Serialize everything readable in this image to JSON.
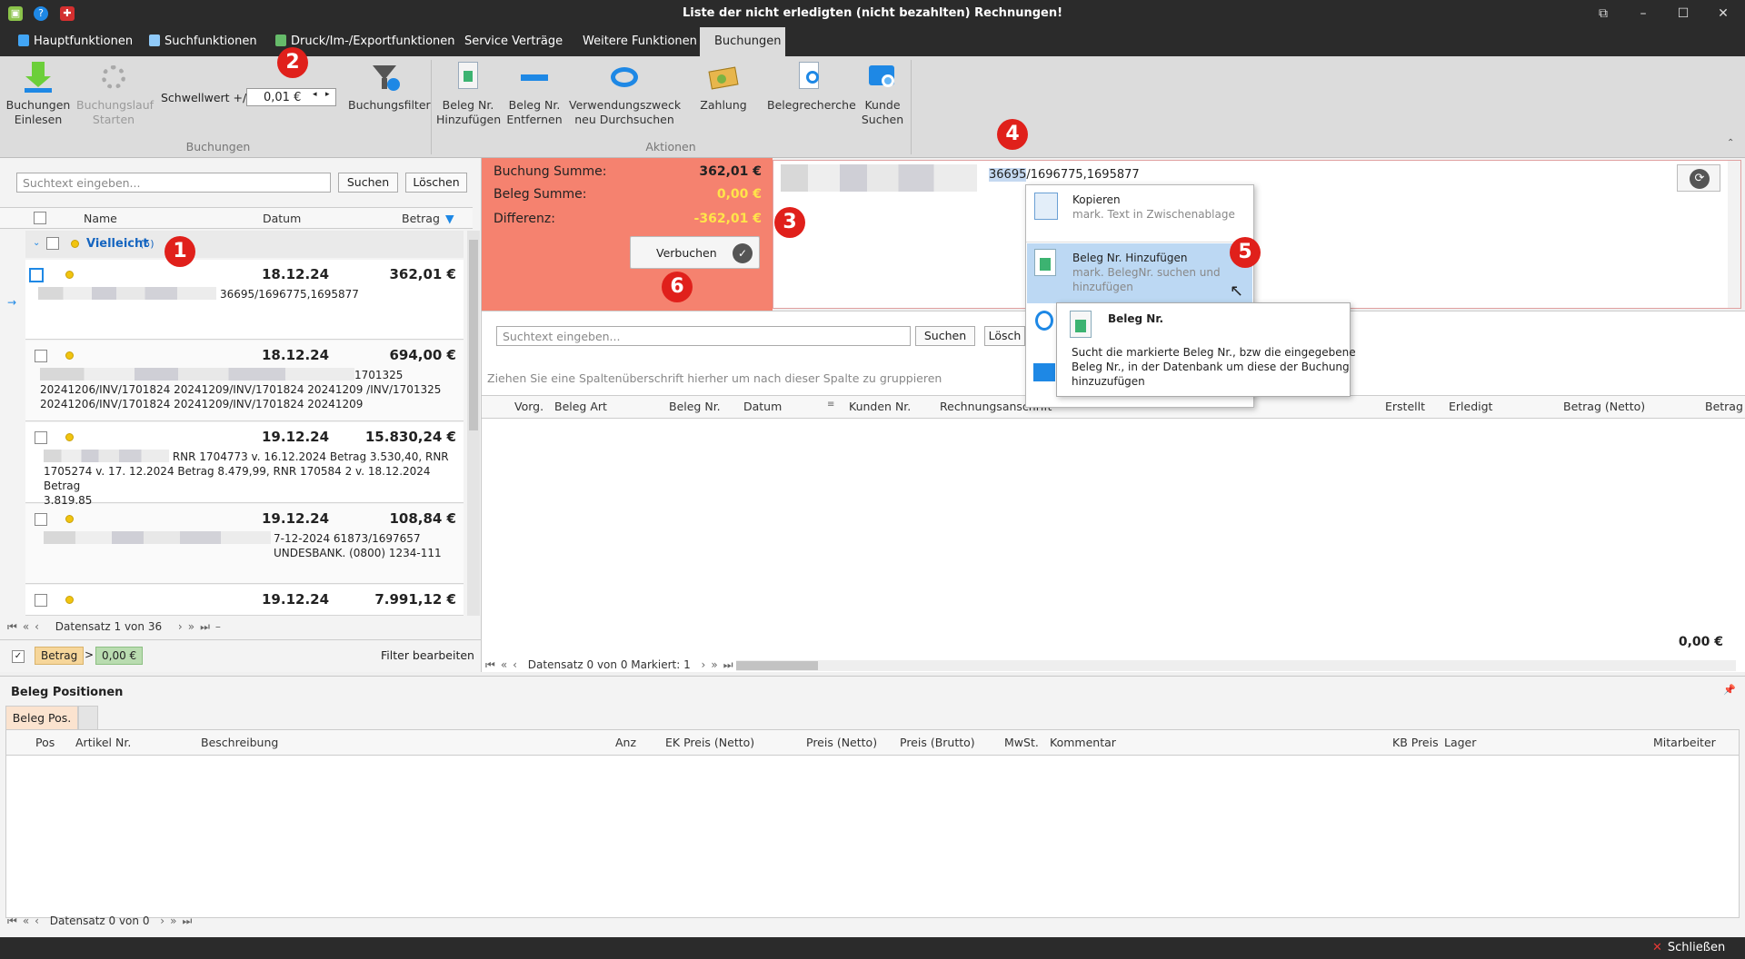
{
  "window": {
    "title": "Liste der nicht erledigten (nicht bezahlten) Rechnungen!"
  },
  "menu": {
    "tabs": [
      "Hauptfunktionen",
      "Suchfunktionen",
      "Druck/Im-/Exportfunktionen",
      "Service Verträge",
      "Weitere Funktionen",
      "Buchungen"
    ],
    "active": "Buchungen"
  },
  "ribbon": {
    "buchungen_einlesen": "Buchungen\nEinlesen",
    "buchungslauf_starten": "Buchungslauf\nStarten",
    "schwellwert_label": "Schwellwert +/-",
    "schwellwert_value": "0,01 €",
    "buchungsfilter": "Buchungsfilter",
    "group_buchungen": "Buchungen",
    "beleg_hinzufuegen": "Beleg Nr.\nHinzufügen",
    "beleg_entfernen": "Beleg Nr.\nEntfernen",
    "verwendungszweck": "Verwendungszweck\nneu Durchsuchen",
    "zahlung": "Zahlung",
    "belegrecherche": "Belegrecherche",
    "kunde_suchen": "Kunde\nSuchen",
    "group_aktionen": "Aktionen"
  },
  "left": {
    "search_placeholder": "Suchtext eingeben...",
    "search_btn": "Suchen",
    "clear_btn": "Löschen",
    "col_name": "Name",
    "col_datum": "Datum",
    "col_betrag": "Betrag",
    "group_label": "Vielleicht",
    "group_count": "(5)",
    "records": [
      {
        "date": "18.12.24",
        "amount": "362,01 €",
        "text": "36695/1696775,1695877"
      },
      {
        "date": "18.12.24",
        "amount": "694,00 €",
        "text1": "1701325",
        "text2": "20241206/INV/1701824 20241209/INV/1701824 20241209 /INV/1701325",
        "text3": "20241206/INV/1701824 20241209/INV/1701824 20241209"
      },
      {
        "date": "19.12.24",
        "amount": "15.830,24 €",
        "text1": "RNR 1704773 v. 16.12.2024 Betrag 3.530,40, RNR",
        "text2": "1705274 v. 17. 12.2024 Betrag 8.479,99, RNR 170584 2 v. 18.12.2024 Betrag",
        "text3": "3.819,85"
      },
      {
        "date": "19.12.24",
        "amount": "108,84 €",
        "text1": "7-12-2024 61873/1697657",
        "text2": "UNDESBANK. (0800) 1234-111"
      },
      {
        "date": "19.12.24",
        "amount": "7.991,12 €"
      }
    ],
    "nav": "Datensatz 1 von 36",
    "filter_betrag": "Betrag",
    "filter_op": ">",
    "filter_value": "0,00 €",
    "filter_edit": "Filter bearbeiten"
  },
  "summary": {
    "buchung_label": "Buchung Summe:",
    "buchung_value": "362,01 €",
    "beleg_label": "Beleg Summe:",
    "beleg_value": "0,00 €",
    "diff_label": "Differenz:",
    "diff_value": "-362,01 €",
    "verbuchen": "Verbuchen"
  },
  "memo": {
    "selected": "36695",
    "rest": "/1696775,1695877"
  },
  "context_menu": {
    "copy_title": "Kopieren",
    "copy_sub": "mark. Text in Zwischenablage",
    "add_title": "Beleg Nr. Hinzufügen",
    "add_sub1": "mark. BelegNr. suchen und",
    "add_sub2": "hinzufügen"
  },
  "tooltip": {
    "title": "Beleg Nr.",
    "l1": "Sucht die markierte Beleg Nr., bzw die eingegebene",
    "l2": "Beleg Nr., in der Datenbank um diese der Buchung",
    "l3": "hinzuzufügen"
  },
  "right": {
    "search_placeholder": "Suchtext eingeben...",
    "search_btn": "Suchen",
    "clear_btn": "Lösch",
    "group_hint": "Ziehen Sie eine Spaltenüberschrift hierher um nach dieser Spalte zu gruppieren",
    "cols": [
      "Vorg.",
      "Beleg Art",
      "Beleg Nr.",
      "Datum",
      "Kunden Nr.",
      "Rechnungsanschrift",
      "Erstellt",
      "Erledigt",
      "Betrag (Netto)",
      "Betrag"
    ],
    "total": "0,00 €",
    "nav": "Datensatz 0 von 0 Markiert: 1"
  },
  "bottom": {
    "title": "Beleg Positionen",
    "tab": "Beleg Pos.",
    "cols": [
      "Pos",
      "Artikel Nr.",
      "Beschreibung",
      "Anz",
      "EK Preis (Netto)",
      "Preis (Netto)",
      "Preis (Brutto)",
      "MwSt.",
      "Kommentar",
      "KB Preis",
      "Lager",
      "Mitarbeiter"
    ],
    "nav": "Datensatz 0 von 0"
  },
  "status": {
    "close": "Schließen"
  },
  "badges": [
    "1",
    "2",
    "3",
    "4",
    "5",
    "6"
  ]
}
